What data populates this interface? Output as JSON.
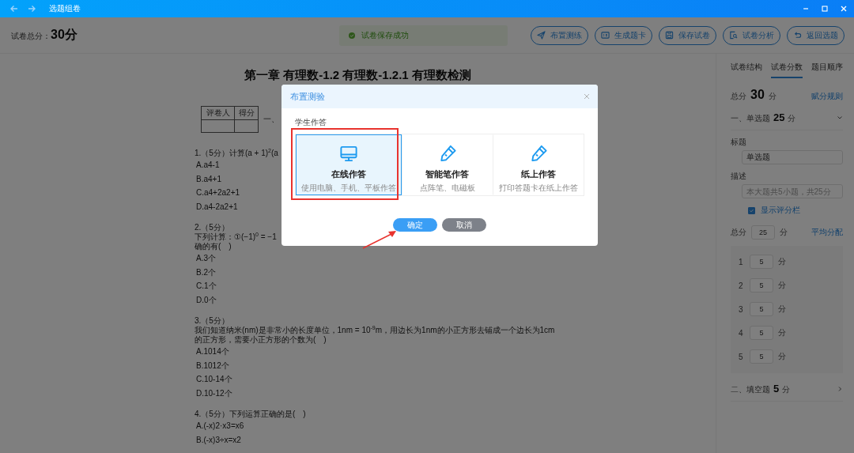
{
  "window": {
    "title": "选题组卷"
  },
  "header": {
    "total_label": "试卷总分：",
    "total_value": "30分",
    "toast": "试卷保存成功",
    "buttons": [
      {
        "label": "布置测练",
        "kind": "send"
      },
      {
        "label": "生成题卡",
        "kind": "card"
      },
      {
        "label": "保存试卷",
        "kind": "save"
      },
      {
        "label": "试卷分析",
        "kind": "analyze"
      },
      {
        "label": "返回选题",
        "kind": "back"
      }
    ]
  },
  "paper": {
    "title": "第一章 有理数-1.2 有理数-1.2.1 有理数检测",
    "grader_table": {
      "columns": [
        "评卷人",
        "得分"
      ]
    },
    "section_heading": "一、",
    "questions": [
      {
        "stem": [
          "1.（5分）计算(a + 1)$^{2}$(a"
        ],
        "options": [
          "A.a4-1",
          "B.a4+1",
          "C.a4+2a2+1",
          "D.a4-2a2+1"
        ]
      },
      {
        "stem": [
          "2.（5分）",
          "下列计算：①(−1)$^{0}$ = −1",
          "确的有(　)"
        ],
        "options": [
          "A.3个",
          "B.2个",
          "C.1个",
          "D.0个"
        ]
      },
      {
        "stem": [
          "3.（5分）",
          "我们知道纳米(nm)是非常小的长度单位，1nm = 10$^{-9}$m，用边长为1nm的小正方形去铺成一个边长为1cm",
          "的正方形，需要小正方形的个数为(　)"
        ],
        "options": [
          "A.1014个",
          "B.1012个",
          "C.10-14个",
          "D.10-12个"
        ]
      },
      {
        "stem": [
          "4.（5分）下列运算正确的是(　)"
        ],
        "options": [
          "A.(-x)2·x3=x6",
          "B.(-x)3÷x=x2"
        ]
      }
    ]
  },
  "side_panel": {
    "tabs": [
      {
        "label": "试卷结构",
        "selected": false
      },
      {
        "label": "试卷分数",
        "selected": true
      },
      {
        "label": "题目顺序",
        "selected": false
      }
    ],
    "total_label": "总分",
    "total_value": "30",
    "total_unit": "分",
    "rule_link": "赋分规则",
    "sections": [
      {
        "heading": "一、单选题",
        "score": "25",
        "unit": "分",
        "expanded": true,
        "title_label": "标题",
        "title_value": "单选题",
        "desc_label": "描述",
        "desc_placeholder": "本大题共5小题，共25分",
        "show_score_bar": {
          "label": "显示评分栏",
          "checked": true
        },
        "total_label": "总分",
        "total_value": "25",
        "total_unit": "分",
        "average_link": "平均分配",
        "items": [
          {
            "number": "1",
            "score": "5",
            "unit": "分"
          },
          {
            "number": "2",
            "score": "5",
            "unit": "分"
          },
          {
            "number": "3",
            "score": "5",
            "unit": "分"
          },
          {
            "number": "4",
            "score": "5",
            "unit": "分"
          },
          {
            "number": "5",
            "score": "5",
            "unit": "分"
          }
        ]
      },
      {
        "heading": "二、填空题",
        "score": "5",
        "unit": "分",
        "expanded": false
      }
    ]
  },
  "dialog": {
    "title": "布置测验",
    "section_label": "学生作答",
    "options": [
      {
        "title": "在线作答",
        "subtitle": "使用电脑、手机、平板作答",
        "kind": "monitor",
        "selected": true
      },
      {
        "title": "智能笔作答",
        "subtitle": "点阵笔、电磁板",
        "kind": "pen",
        "selected": false
      },
      {
        "title": "纸上作答",
        "subtitle": "打印答题卡在纸上作答",
        "kind": "pen",
        "selected": false
      }
    ],
    "buttons": [
      {
        "label": "确定",
        "kind": "primary"
      },
      {
        "label": "取消",
        "kind": "secondary"
      }
    ]
  }
}
